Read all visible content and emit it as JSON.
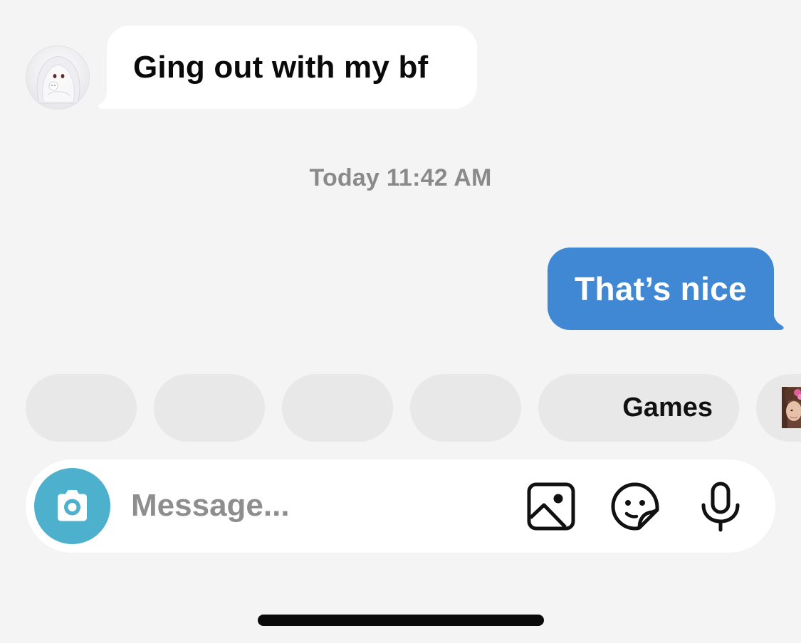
{
  "conversation": {
    "incoming_message": {
      "text": "Ging out with my bf",
      "avatar_icon": "anime-avatar-icon"
    },
    "timestamp": "Today 11:42 AM",
    "outgoing_message": {
      "text": "That’s nice"
    }
  },
  "quick_replies": {
    "chips": [
      {
        "label": ""
      },
      {
        "label": ""
      },
      {
        "label": ""
      },
      {
        "label": ""
      },
      {
        "label": "Games"
      },
      {
        "label": "",
        "thumbnail_icon": "photo-thumbnail-icon"
      }
    ]
  },
  "composer": {
    "placeholder": "Message...",
    "camera_icon": "camera-icon",
    "gallery_icon": "image-icon",
    "sticker_icon": "sticker-icon",
    "mic_icon": "microphone-icon"
  },
  "colors": {
    "background": "#f4f4f4",
    "outgoing_bubble": "#4188d4",
    "camera_button": "#4db0cc",
    "chip_background": "#e8e8e8",
    "timestamp_text": "#8a8a8a"
  }
}
